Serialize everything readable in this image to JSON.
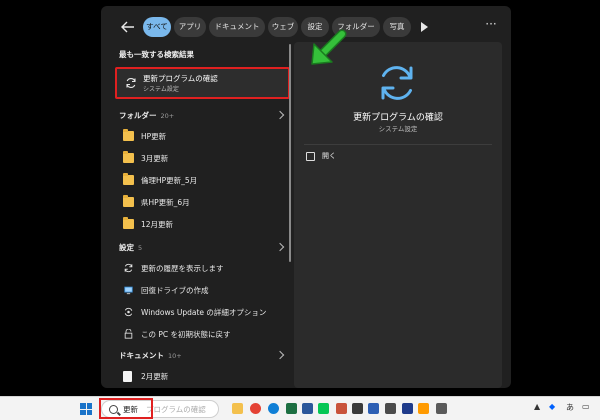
{
  "filters": {
    "tabs": [
      {
        "label": "すべて",
        "active": true
      },
      {
        "label": "アプリ",
        "active": false
      },
      {
        "label": "ドキュメント",
        "active": false
      },
      {
        "label": "ウェブ",
        "active": false
      },
      {
        "label": "設定",
        "active": false
      },
      {
        "label": "フォルダー",
        "active": false
      },
      {
        "label": "写真",
        "active": false
      }
    ],
    "more_label": "···"
  },
  "best_match": {
    "header": "最も一致する検索結果",
    "title": "更新プログラムの確認",
    "subtitle": "システム設定"
  },
  "folders": {
    "header": "フォルダー",
    "count": "20+",
    "items": [
      "HP更新",
      "3月更新",
      "倫理HP更新_5月",
      "県HP更新_6月",
      "12月更新"
    ]
  },
  "settings": {
    "header": "設定",
    "count": "5",
    "items": [
      "更新の履歴を表示します",
      "回復ドライブの作成",
      "Windows Update の詳細オプション",
      "この PC を初期状態に戻す"
    ]
  },
  "documents": {
    "header": "ドキュメント",
    "count": "10+",
    "items": [
      "2月更新"
    ]
  },
  "preview": {
    "title": "更新プログラムの確認",
    "subtitle": "システム設定",
    "open_label": "開く"
  },
  "taskbar": {
    "search_text": "更新",
    "search_ghost": "プログラムの確認",
    "ime_label": "あ"
  },
  "colors": {
    "accent": "#7ab8ec",
    "highlight": "#e02020",
    "arrow": "#35c03a"
  }
}
